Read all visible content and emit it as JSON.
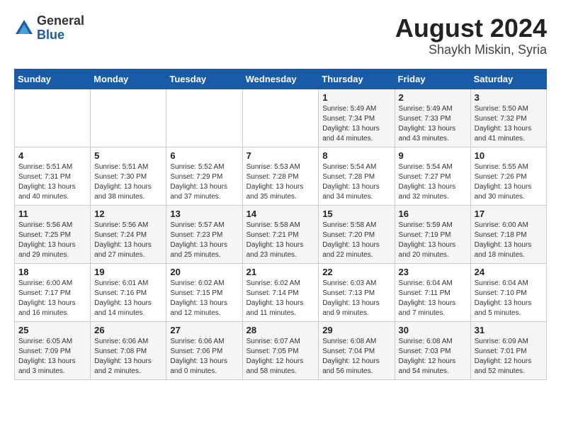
{
  "header": {
    "logo_line1": "General",
    "logo_line2": "Blue",
    "month_year": "August 2024",
    "location": "Shaykh Miskin, Syria"
  },
  "weekdays": [
    "Sunday",
    "Monday",
    "Tuesday",
    "Wednesday",
    "Thursday",
    "Friday",
    "Saturday"
  ],
  "weeks": [
    [
      {
        "day": "",
        "detail": ""
      },
      {
        "day": "",
        "detail": ""
      },
      {
        "day": "",
        "detail": ""
      },
      {
        "day": "",
        "detail": ""
      },
      {
        "day": "1",
        "detail": "Sunrise: 5:49 AM\nSunset: 7:34 PM\nDaylight: 13 hours\nand 44 minutes."
      },
      {
        "day": "2",
        "detail": "Sunrise: 5:49 AM\nSunset: 7:33 PM\nDaylight: 13 hours\nand 43 minutes."
      },
      {
        "day": "3",
        "detail": "Sunrise: 5:50 AM\nSunset: 7:32 PM\nDaylight: 13 hours\nand 41 minutes."
      }
    ],
    [
      {
        "day": "4",
        "detail": "Sunrise: 5:51 AM\nSunset: 7:31 PM\nDaylight: 13 hours\nand 40 minutes."
      },
      {
        "day": "5",
        "detail": "Sunrise: 5:51 AM\nSunset: 7:30 PM\nDaylight: 13 hours\nand 38 minutes."
      },
      {
        "day": "6",
        "detail": "Sunrise: 5:52 AM\nSunset: 7:29 PM\nDaylight: 13 hours\nand 37 minutes."
      },
      {
        "day": "7",
        "detail": "Sunrise: 5:53 AM\nSunset: 7:28 PM\nDaylight: 13 hours\nand 35 minutes."
      },
      {
        "day": "8",
        "detail": "Sunrise: 5:54 AM\nSunset: 7:28 PM\nDaylight: 13 hours\nand 34 minutes."
      },
      {
        "day": "9",
        "detail": "Sunrise: 5:54 AM\nSunset: 7:27 PM\nDaylight: 13 hours\nand 32 minutes."
      },
      {
        "day": "10",
        "detail": "Sunrise: 5:55 AM\nSunset: 7:26 PM\nDaylight: 13 hours\nand 30 minutes."
      }
    ],
    [
      {
        "day": "11",
        "detail": "Sunrise: 5:56 AM\nSunset: 7:25 PM\nDaylight: 13 hours\nand 29 minutes."
      },
      {
        "day": "12",
        "detail": "Sunrise: 5:56 AM\nSunset: 7:24 PM\nDaylight: 13 hours\nand 27 minutes."
      },
      {
        "day": "13",
        "detail": "Sunrise: 5:57 AM\nSunset: 7:23 PM\nDaylight: 13 hours\nand 25 minutes."
      },
      {
        "day": "14",
        "detail": "Sunrise: 5:58 AM\nSunset: 7:21 PM\nDaylight: 13 hours\nand 23 minutes."
      },
      {
        "day": "15",
        "detail": "Sunrise: 5:58 AM\nSunset: 7:20 PM\nDaylight: 13 hours\nand 22 minutes."
      },
      {
        "day": "16",
        "detail": "Sunrise: 5:59 AM\nSunset: 7:19 PM\nDaylight: 13 hours\nand 20 minutes."
      },
      {
        "day": "17",
        "detail": "Sunrise: 6:00 AM\nSunset: 7:18 PM\nDaylight: 13 hours\nand 18 minutes."
      }
    ],
    [
      {
        "day": "18",
        "detail": "Sunrise: 6:00 AM\nSunset: 7:17 PM\nDaylight: 13 hours\nand 16 minutes."
      },
      {
        "day": "19",
        "detail": "Sunrise: 6:01 AM\nSunset: 7:16 PM\nDaylight: 13 hours\nand 14 minutes."
      },
      {
        "day": "20",
        "detail": "Sunrise: 6:02 AM\nSunset: 7:15 PM\nDaylight: 13 hours\nand 12 minutes."
      },
      {
        "day": "21",
        "detail": "Sunrise: 6:02 AM\nSunset: 7:14 PM\nDaylight: 13 hours\nand 11 minutes."
      },
      {
        "day": "22",
        "detail": "Sunrise: 6:03 AM\nSunset: 7:13 PM\nDaylight: 13 hours\nand 9 minutes."
      },
      {
        "day": "23",
        "detail": "Sunrise: 6:04 AM\nSunset: 7:11 PM\nDaylight: 13 hours\nand 7 minutes."
      },
      {
        "day": "24",
        "detail": "Sunrise: 6:04 AM\nSunset: 7:10 PM\nDaylight: 13 hours\nand 5 minutes."
      }
    ],
    [
      {
        "day": "25",
        "detail": "Sunrise: 6:05 AM\nSunset: 7:09 PM\nDaylight: 13 hours\nand 3 minutes."
      },
      {
        "day": "26",
        "detail": "Sunrise: 6:06 AM\nSunset: 7:08 PM\nDaylight: 13 hours\nand 2 minutes."
      },
      {
        "day": "27",
        "detail": "Sunrise: 6:06 AM\nSunset: 7:06 PM\nDaylight: 13 hours\nand 0 minutes."
      },
      {
        "day": "28",
        "detail": "Sunrise: 6:07 AM\nSunset: 7:05 PM\nDaylight: 12 hours\nand 58 minutes."
      },
      {
        "day": "29",
        "detail": "Sunrise: 6:08 AM\nSunset: 7:04 PM\nDaylight: 12 hours\nand 56 minutes."
      },
      {
        "day": "30",
        "detail": "Sunrise: 6:08 AM\nSunset: 7:03 PM\nDaylight: 12 hours\nand 54 minutes."
      },
      {
        "day": "31",
        "detail": "Sunrise: 6:09 AM\nSunset: 7:01 PM\nDaylight: 12 hours\nand 52 minutes."
      }
    ]
  ]
}
